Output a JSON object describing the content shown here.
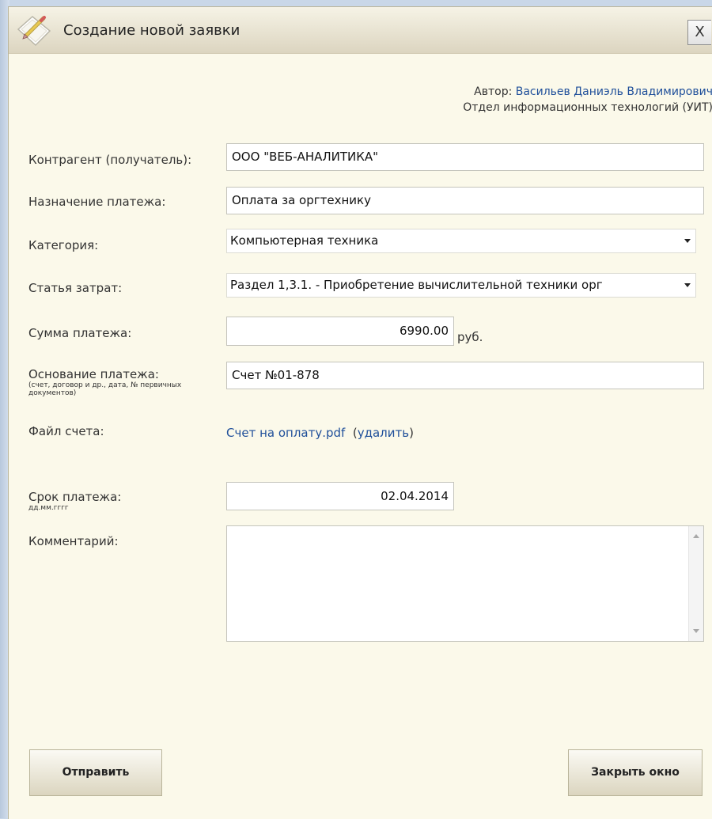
{
  "dialog": {
    "title": "Создание новой заявки",
    "close_label": "X"
  },
  "author": {
    "label": "Автор:",
    "name": "Васильев Даниэль Владимирович",
    "department": "Отдел информационных технологий (УИТ)"
  },
  "form": {
    "counterparty": {
      "label": "Контрагент (получатель):",
      "value": "ООО \"ВЕБ-АНАЛИТИКА\""
    },
    "purpose": {
      "label": "Назначение платежа:",
      "value": "Оплата за оргтехнику"
    },
    "category": {
      "label": "Категория:",
      "selected": "Компьютерная техника"
    },
    "cost_item": {
      "label": "Статья затрат:",
      "selected": "Раздел 1,3.1. - Приобретение вычислительной техники орг"
    },
    "amount": {
      "label": "Сумма платежа:",
      "value": "6990.00",
      "unit": "руб."
    },
    "basis": {
      "label": "Основание платежа:",
      "hint": "(счет, договор и др., дата, № первичных документов)",
      "value": "Счет №01-878"
    },
    "invoice_file": {
      "label": "Файл счета:",
      "file_name": "Счет на оплату.pdf",
      "delete_label": "удалить"
    },
    "due_date": {
      "label": "Срок платежа:",
      "hint": "дд.мм.гггг",
      "value": "02.04.2014"
    },
    "comment": {
      "label": "Комментарий:",
      "value": ""
    }
  },
  "buttons": {
    "submit": "Отправить",
    "close_window": "Закрыть окно"
  },
  "icons": {
    "title_icon": "pencil-paper-icon",
    "select_arrow": "dropdown-arrow-icon"
  }
}
